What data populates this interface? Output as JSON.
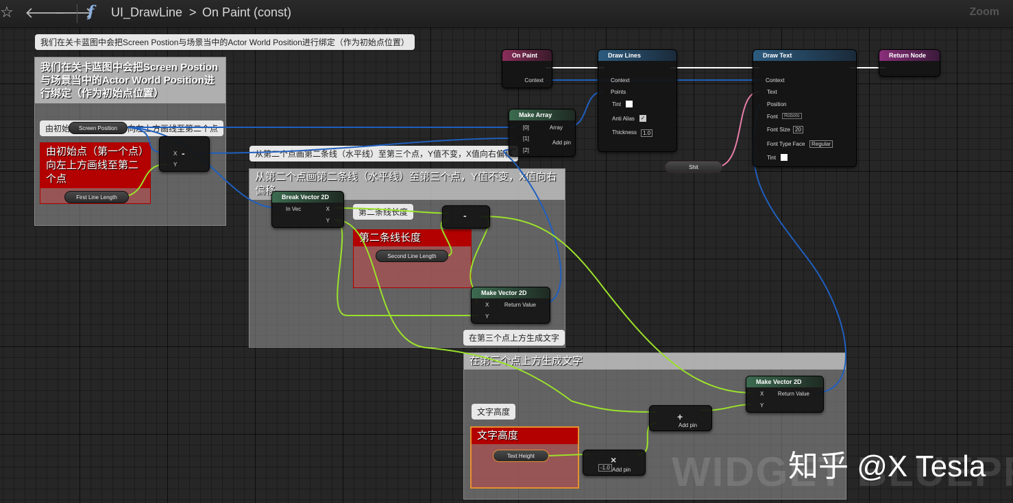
{
  "toolbar": {
    "star_icon": "star-icon",
    "back_icon": "arrow-left-icon",
    "forward_icon": "arrow-right-icon",
    "function_icon": "f",
    "breadcrumb_root": "UI_DrawLine",
    "breadcrumb_sep": ">",
    "breadcrumb_current": "On Paint (const)",
    "zoom_label": "Zoom"
  },
  "comments": {
    "c1_bubble": "我们在关卡蓝图中会把Screen Postion与场景当中的Actor World Position进行绑定（作为初始点位置）",
    "c1_title": "我们在关卡蓝图中会把Screen Postion与场景当中的Actor World Position进行绑定（作为初始点位置）",
    "c2_bubble": "由初始点（第一个点）向左上方画线至第二个点",
    "c2_title": "由初始点（第一个点）向左上方画线至第二个点",
    "c3_bubble": "从第二个点画第二条线（水平线）至第三个点，Y值不变，X值向右偏移",
    "c3_title": "从第二个点画第二条线（水平线）至第三个点，Y值不变，X值向右偏移",
    "c4_bubble": "第二条线长度",
    "c4_title": "第二条线长度",
    "c5_bubble": "在第三个点上方生成文字",
    "c5_title": "在第三个点上方生成文字",
    "c6_bubble": "文字高度",
    "c6_title": "文字高度"
  },
  "nodes": {
    "on_paint": {
      "title": "On Paint",
      "context": "Context"
    },
    "draw_lines": {
      "title": "Draw Lines",
      "context": "Context",
      "points": "Points",
      "tint": "Tint",
      "anti_alias": "Anti Alias",
      "thickness": "Thickness",
      "thickness_value": "1.0"
    },
    "draw_text": {
      "title": "Draw Text",
      "context": "Context",
      "text": "Text",
      "position": "Position",
      "font": "Font",
      "font_value": "Roboto",
      "font_size": "Font Size",
      "font_size_value": "20",
      "font_type_face": "Font Type Face",
      "font_type_face_value": "Regular",
      "tint": "Tint"
    },
    "return_node": {
      "title": "Return Node"
    },
    "make_array": {
      "title": "Make Array",
      "pin0": "[0]",
      "pin1": "[1]",
      "pin2": "[2]",
      "array": "Array",
      "add_pin": "Add pin"
    },
    "break_vector": {
      "title": "Break Vector 2D",
      "in_vec": "In Vec",
      "x": "X",
      "y": "Y"
    },
    "make_vector_1": {
      "title": "Make Vector 2D",
      "x": "X",
      "y": "Y",
      "return": "Return Value"
    },
    "make_vector_2": {
      "title": "Make Vector 2D",
      "x": "X",
      "y": "Y",
      "return": "Return Value"
    },
    "minus_1": {
      "x": "X",
      "y": "Y",
      "op": "-"
    },
    "minus_2": {
      "op": "-"
    },
    "plus": {
      "op": "+",
      "add_pin": "Add pin"
    },
    "multiply": {
      "op": "×",
      "value": "-1.0",
      "add_pin": "Add pin"
    }
  },
  "variables": {
    "screen_position": "Screen Position",
    "first_line_length": "First Line Length",
    "second_line_length": "Second Line Length",
    "text_height": "Text Height",
    "shit": "Shit"
  },
  "watermark": {
    "text": "知乎 @X Tesla",
    "background": "WIDGET BLUEPRINT"
  },
  "colors": {
    "exec": "#ffffff",
    "vector": "#1f5fbf",
    "float": "#9be22a",
    "text": "#e87fa9",
    "comment_red": "#b30000"
  }
}
